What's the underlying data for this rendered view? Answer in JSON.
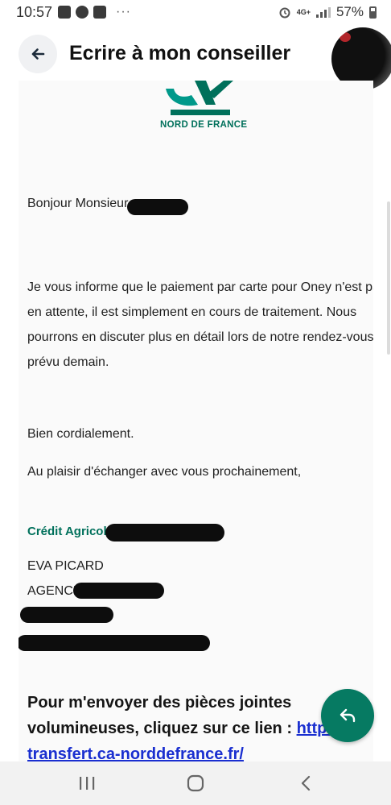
{
  "status_bar": {
    "time": "10:57",
    "more": "···",
    "network": "4G+",
    "battery": "57%"
  },
  "header": {
    "title": "Ecrire à mon conseiller"
  },
  "message": {
    "bank_region": "NORD DE FRANCE",
    "greeting": "Bonjour Monsieur",
    "body_lines": [
      "Je vous informe que le paiement par carte pour Oney n'est pas",
      "en attente, il est simplement en cours de traitement. Nous",
      "pourrons en discuter plus en détail lors de notre rendez-vous",
      "prévu demain."
    ],
    "closing": "Bien cordialement.",
    "closing2": "Au plaisir d'échanger avec vous prochainement,",
    "signature": {
      "company": "Crédit Agricol",
      "advisor": "EVA PICARD",
      "agency": "AGENCE"
    },
    "attachment_note": "Pour m'envoyer des pièces jointes volumineuses, cliquez sur ce lien : ",
    "attachment_link": "https:// transfert.ca-norddefrance.fr/"
  },
  "colors": {
    "brand_green": "#067a62",
    "link_blue": "#1a2fd0"
  },
  "icons": {
    "back": "arrow-left-icon",
    "reply": "reply-icon",
    "nav_recent": "recent-apps-icon",
    "nav_home": "home-icon",
    "nav_back": "chevron-left-icon"
  }
}
